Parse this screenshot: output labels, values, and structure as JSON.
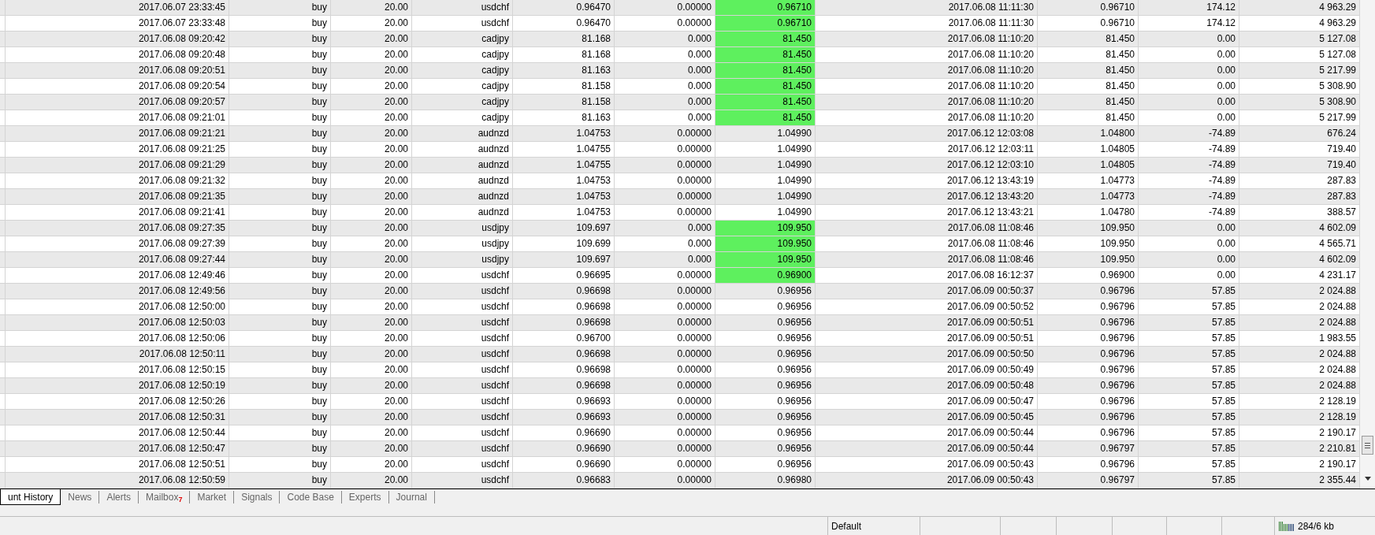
{
  "rows": [
    {
      "cells": [
        "2017.06.07 23:33:45",
        "buy",
        "20.00",
        "usdchf",
        "0.96470",
        "0.00000",
        "0.96710",
        "2017.06.08 11:11:30",
        "0.96710",
        "174.12",
        "4 963.29"
      ],
      "highlighted": true
    },
    {
      "cells": [
        "2017.06.07 23:33:48",
        "buy",
        "20.00",
        "usdchf",
        "0.96470",
        "0.00000",
        "0.96710",
        "2017.06.08 11:11:30",
        "0.96710",
        "174.12",
        "4 963.29"
      ],
      "highlighted": true
    },
    {
      "cells": [
        "2017.06.08 09:20:42",
        "buy",
        "20.00",
        "cadjpy",
        "81.168",
        "0.000",
        "81.450",
        "2017.06.08 11:10:20",
        "81.450",
        "0.00",
        "5 127.08"
      ],
      "highlighted": true
    },
    {
      "cells": [
        "2017.06.08 09:20:48",
        "buy",
        "20.00",
        "cadjpy",
        "81.168",
        "0.000",
        "81.450",
        "2017.06.08 11:10:20",
        "81.450",
        "0.00",
        "5 127.08"
      ],
      "highlighted": true
    },
    {
      "cells": [
        "2017.06.08 09:20:51",
        "buy",
        "20.00",
        "cadjpy",
        "81.163",
        "0.000",
        "81.450",
        "2017.06.08 11:10:20",
        "81.450",
        "0.00",
        "5 217.99"
      ],
      "highlighted": true
    },
    {
      "cells": [
        "2017.06.08 09:20:54",
        "buy",
        "20.00",
        "cadjpy",
        "81.158",
        "0.000",
        "81.450",
        "2017.06.08 11:10:20",
        "81.450",
        "0.00",
        "5 308.90"
      ],
      "highlighted": true
    },
    {
      "cells": [
        "2017.06.08 09:20:57",
        "buy",
        "20.00",
        "cadjpy",
        "81.158",
        "0.000",
        "81.450",
        "2017.06.08 11:10:20",
        "81.450",
        "0.00",
        "5 308.90"
      ],
      "highlighted": true
    },
    {
      "cells": [
        "2017.06.08 09:21:01",
        "buy",
        "20.00",
        "cadjpy",
        "81.163",
        "0.000",
        "81.450",
        "2017.06.08 11:10:20",
        "81.450",
        "0.00",
        "5 217.99"
      ],
      "highlighted": true
    },
    {
      "cells": [
        "2017.06.08 09:21:21",
        "buy",
        "20.00",
        "audnzd",
        "1.04753",
        "0.00000",
        "1.04990",
        "2017.06.12 12:03:08",
        "1.04800",
        "-74.89",
        "676.24"
      ],
      "highlighted": false
    },
    {
      "cells": [
        "2017.06.08 09:21:25",
        "buy",
        "20.00",
        "audnzd",
        "1.04755",
        "0.00000",
        "1.04990",
        "2017.06.12 12:03:11",
        "1.04805",
        "-74.89",
        "719.40"
      ],
      "highlighted": false
    },
    {
      "cells": [
        "2017.06.08 09:21:29",
        "buy",
        "20.00",
        "audnzd",
        "1.04755",
        "0.00000",
        "1.04990",
        "2017.06.12 12:03:10",
        "1.04805",
        "-74.89",
        "719.40"
      ],
      "highlighted": false
    },
    {
      "cells": [
        "2017.06.08 09:21:32",
        "buy",
        "20.00",
        "audnzd",
        "1.04753",
        "0.00000",
        "1.04990",
        "2017.06.12 13:43:19",
        "1.04773",
        "-74.89",
        "287.83"
      ],
      "highlighted": false
    },
    {
      "cells": [
        "2017.06.08 09:21:35",
        "buy",
        "20.00",
        "audnzd",
        "1.04753",
        "0.00000",
        "1.04990",
        "2017.06.12 13:43:20",
        "1.04773",
        "-74.89",
        "287.83"
      ],
      "highlighted": false
    },
    {
      "cells": [
        "2017.06.08 09:21:41",
        "buy",
        "20.00",
        "audnzd",
        "1.04753",
        "0.00000",
        "1.04990",
        "2017.06.12 13:43:21",
        "1.04780",
        "-74.89",
        "388.57"
      ],
      "highlighted": false
    },
    {
      "cells": [
        "2017.06.08 09:27:35",
        "buy",
        "20.00",
        "usdjpy",
        "109.697",
        "0.000",
        "109.950",
        "2017.06.08 11:08:46",
        "109.950",
        "0.00",
        "4 602.09"
      ],
      "highlighted": true
    },
    {
      "cells": [
        "2017.06.08 09:27:39",
        "buy",
        "20.00",
        "usdjpy",
        "109.699",
        "0.000",
        "109.950",
        "2017.06.08 11:08:46",
        "109.950",
        "0.00",
        "4 565.71"
      ],
      "highlighted": true
    },
    {
      "cells": [
        "2017.06.08 09:27:44",
        "buy",
        "20.00",
        "usdjpy",
        "109.697",
        "0.000",
        "109.950",
        "2017.06.08 11:08:46",
        "109.950",
        "0.00",
        "4 602.09"
      ],
      "highlighted": true
    },
    {
      "cells": [
        "2017.06.08 12:49:46",
        "buy",
        "20.00",
        "usdchf",
        "0.96695",
        "0.00000",
        "0.96900",
        "2017.06.08 16:12:37",
        "0.96900",
        "0.00",
        "4 231.17"
      ],
      "highlighted": true
    },
    {
      "cells": [
        "2017.06.08 12:49:56",
        "buy",
        "20.00",
        "usdchf",
        "0.96698",
        "0.00000",
        "0.96956",
        "2017.06.09 00:50:37",
        "0.96796",
        "57.85",
        "2 024.88"
      ],
      "highlighted": false
    },
    {
      "cells": [
        "2017.06.08 12:50:00",
        "buy",
        "20.00",
        "usdchf",
        "0.96698",
        "0.00000",
        "0.96956",
        "2017.06.09 00:50:52",
        "0.96796",
        "57.85",
        "2 024.88"
      ],
      "highlighted": false
    },
    {
      "cells": [
        "2017.06.08 12:50:03",
        "buy",
        "20.00",
        "usdchf",
        "0.96698",
        "0.00000",
        "0.96956",
        "2017.06.09 00:50:51",
        "0.96796",
        "57.85",
        "2 024.88"
      ],
      "highlighted": false
    },
    {
      "cells": [
        "2017.06.08 12:50:06",
        "buy",
        "20.00",
        "usdchf",
        "0.96700",
        "0.00000",
        "0.96956",
        "2017.06.09 00:50:51",
        "0.96796",
        "57.85",
        "1 983.55"
      ],
      "highlighted": false
    },
    {
      "cells": [
        "2017.06.08 12:50:11",
        "buy",
        "20.00",
        "usdchf",
        "0.96698",
        "0.00000",
        "0.96956",
        "2017.06.09 00:50:50",
        "0.96796",
        "57.85",
        "2 024.88"
      ],
      "highlighted": false
    },
    {
      "cells": [
        "2017.06.08 12:50:15",
        "buy",
        "20.00",
        "usdchf",
        "0.96698",
        "0.00000",
        "0.96956",
        "2017.06.09 00:50:49",
        "0.96796",
        "57.85",
        "2 024.88"
      ],
      "highlighted": false
    },
    {
      "cells": [
        "2017.06.08 12:50:19",
        "buy",
        "20.00",
        "usdchf",
        "0.96698",
        "0.00000",
        "0.96956",
        "2017.06.09 00:50:48",
        "0.96796",
        "57.85",
        "2 024.88"
      ],
      "highlighted": false
    },
    {
      "cells": [
        "2017.06.08 12:50:26",
        "buy",
        "20.00",
        "usdchf",
        "0.96693",
        "0.00000",
        "0.96956",
        "2017.06.09 00:50:47",
        "0.96796",
        "57.85",
        "2 128.19"
      ],
      "highlighted": false
    },
    {
      "cells": [
        "2017.06.08 12:50:31",
        "buy",
        "20.00",
        "usdchf",
        "0.96693",
        "0.00000",
        "0.96956",
        "2017.06.09 00:50:45",
        "0.96796",
        "57.85",
        "2 128.19"
      ],
      "highlighted": false
    },
    {
      "cells": [
        "2017.06.08 12:50:44",
        "buy",
        "20.00",
        "usdchf",
        "0.96690",
        "0.00000",
        "0.96956",
        "2017.06.09 00:50:44",
        "0.96796",
        "57.85",
        "2 190.17"
      ],
      "highlighted": false
    },
    {
      "cells": [
        "2017.06.08 12:50:47",
        "buy",
        "20.00",
        "usdchf",
        "0.96690",
        "0.00000",
        "0.96956",
        "2017.06.09 00:50:44",
        "0.96797",
        "57.85",
        "2 210.81"
      ],
      "highlighted": false
    },
    {
      "cells": [
        "2017.06.08 12:50:51",
        "buy",
        "20.00",
        "usdchf",
        "0.96690",
        "0.00000",
        "0.96956",
        "2017.06.09 00:50:43",
        "0.96796",
        "57.85",
        "2 190.17"
      ],
      "highlighted": false
    },
    {
      "cells": [
        "2017.06.08 12:50:59",
        "buy",
        "20.00",
        "usdchf",
        "0.96683",
        "0.00000",
        "0.96980",
        "2017.06.09 00:50:43",
        "0.96797",
        "57.85",
        "2 355.44"
      ],
      "highlighted": false
    }
  ],
  "tabs": [
    {
      "label": "unt History",
      "selected": true
    },
    {
      "label": "News",
      "selected": false
    },
    {
      "label": "Alerts",
      "selected": false
    },
    {
      "label": "Mailbox",
      "badge": "7",
      "selected": false
    },
    {
      "label": "Market",
      "selected": false
    },
    {
      "label": "Signals",
      "selected": false
    },
    {
      "label": "Code Base",
      "selected": false
    },
    {
      "label": "Experts",
      "selected": false
    },
    {
      "label": "Journal",
      "selected": false
    }
  ],
  "status_bar": {
    "profile": "Default",
    "traffic": "284/6 kb"
  }
}
